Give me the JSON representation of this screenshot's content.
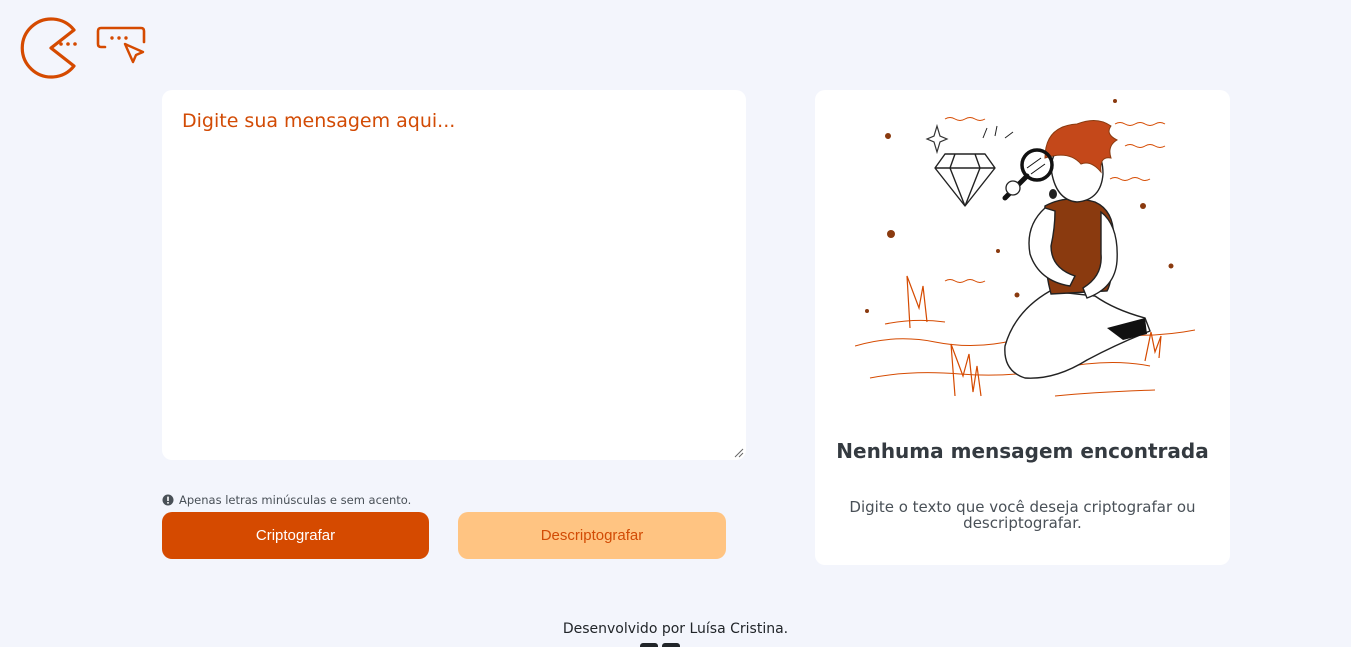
{
  "logo": {
    "icon": "pacman-logo-icon",
    "secondary_icon": "message-cursor-icon"
  },
  "input": {
    "placeholder": "Digite sua mensagem aqui..."
  },
  "hint": {
    "icon": "info-icon",
    "text": "Apenas letras minúsculas e sem acento."
  },
  "buttons": {
    "encrypt": "Criptografar",
    "decrypt": "Descriptografar"
  },
  "output": {
    "illustration": "person-with-magnifier-illustration",
    "title": "Nenhuma mensagem encontrada",
    "description": "Digite o texto que você deseja criptografar ou descriptografar."
  },
  "footer": {
    "credit": "Desenvolvido por Luísa Cristina."
  },
  "colors": {
    "accent": "#d54a00",
    "accent_light": "#ffc482",
    "background": "#f3f5fc",
    "card": "#ffffff"
  }
}
